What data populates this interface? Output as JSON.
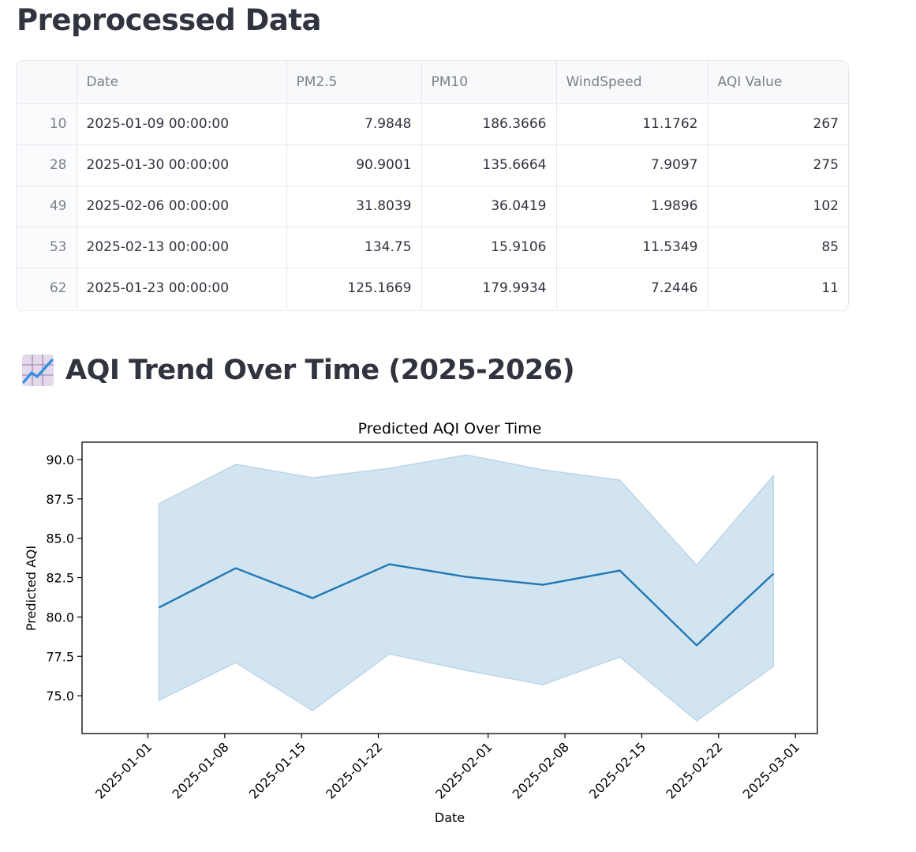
{
  "page": {
    "title": "Preprocessed Data"
  },
  "table": {
    "columns": [
      "",
      "Date",
      "PM2.5",
      "PM10",
      "WindSpeed",
      "AQI Value"
    ],
    "rows": [
      {
        "index": "10",
        "date": "2025-01-09 00:00:00",
        "pm25": "7.9848",
        "pm10": "186.3666",
        "wind": "11.1762",
        "aqi": "267"
      },
      {
        "index": "28",
        "date": "2025-01-30 00:00:00",
        "pm25": "90.9001",
        "pm10": "135.6664",
        "wind": "7.9097",
        "aqi": "275"
      },
      {
        "index": "49",
        "date": "2025-02-06 00:00:00",
        "pm25": "31.8039",
        "pm10": "36.0419",
        "wind": "1.9896",
        "aqi": "102"
      },
      {
        "index": "53",
        "date": "2025-02-13 00:00:00",
        "pm25": "134.75",
        "pm10": "15.9106",
        "wind": "11.5349",
        "aqi": "85"
      },
      {
        "index": "62",
        "date": "2025-01-23 00:00:00",
        "pm25": "125.1669",
        "pm10": "179.9934",
        "wind": "7.2446",
        "aqi": "11"
      }
    ]
  },
  "section": {
    "icon": "chart-increasing-icon",
    "title": "AQI Trend Over Time (2025-2026)"
  },
  "chart_data": {
    "type": "line",
    "title": "Predicted AQI Over Time",
    "xlabel": "Date",
    "ylabel": "Predicted AQI",
    "x_ticks": [
      "2025-01-01",
      "2025-01-08",
      "2025-01-15",
      "2025-01-22",
      "2025-02-01",
      "2025-02-08",
      "2025-02-15",
      "2025-02-22",
      "2025-03-01"
    ],
    "y_ticks": [
      "75.0",
      "77.5",
      "80.0",
      "82.5",
      "85.0",
      "87.5",
      "90.0"
    ],
    "xlim": [
      "2024-12-26",
      "2025-03-03"
    ],
    "ylim": [
      72.6,
      91.1
    ],
    "x": [
      "2025-01-02",
      "2025-01-09",
      "2025-01-16",
      "2025-01-23",
      "2025-01-30",
      "2025-02-06",
      "2025-02-13",
      "2025-02-20",
      "2025-02-27"
    ],
    "series": [
      {
        "values": [
          80.6,
          83.1,
          81.2,
          83.35,
          82.55,
          82.05,
          82.95,
          78.2,
          82.75
        ],
        "lower": [
          74.7,
          77.1,
          74.05,
          77.65,
          76.6,
          75.7,
          77.45,
          73.4,
          76.85
        ],
        "upper": [
          87.2,
          89.7,
          88.85,
          89.45,
          90.3,
          89.35,
          88.7,
          83.3,
          89.0
        ],
        "color": "#1f77b4",
        "band_color": "#1f77b4"
      }
    ],
    "grid": false,
    "legend": "none"
  }
}
